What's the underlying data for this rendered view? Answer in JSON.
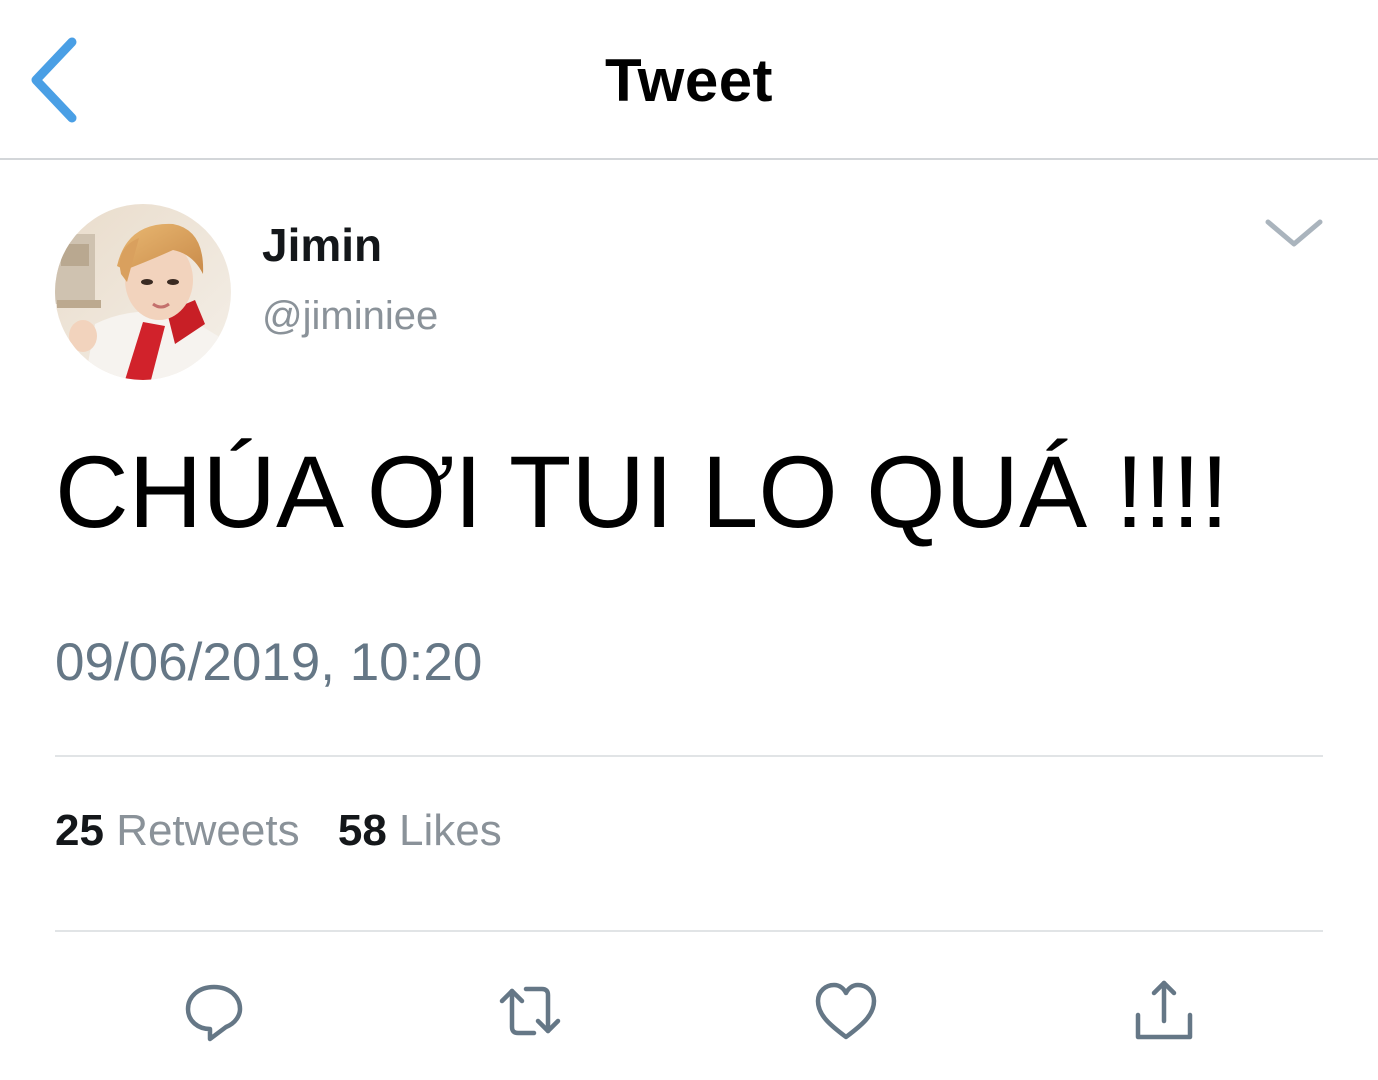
{
  "nav": {
    "title": "Tweet",
    "back_icon": "chevron-left-icon",
    "accent_color": "#4a9fe5"
  },
  "author": {
    "display_name": "Jimin",
    "handle": "@jiminiee",
    "avatar": "profile-photo"
  },
  "tweet": {
    "text": "CHÚA ƠI TUI LO QUÁ !!!!",
    "timestamp": "09/06/2019, 10:20"
  },
  "stats": {
    "retweets_count": "25",
    "retweets_label": "Retweets",
    "likes_count": "58",
    "likes_label": "Likes"
  },
  "actions": [
    {
      "icon": "reply-icon"
    },
    {
      "icon": "retweet-icon"
    },
    {
      "icon": "like-icon"
    },
    {
      "icon": "share-icon"
    }
  ],
  "colors": {
    "icon_gray": "#657786",
    "divider": "#e1e4e6",
    "secondary_text": "#8a9299"
  }
}
